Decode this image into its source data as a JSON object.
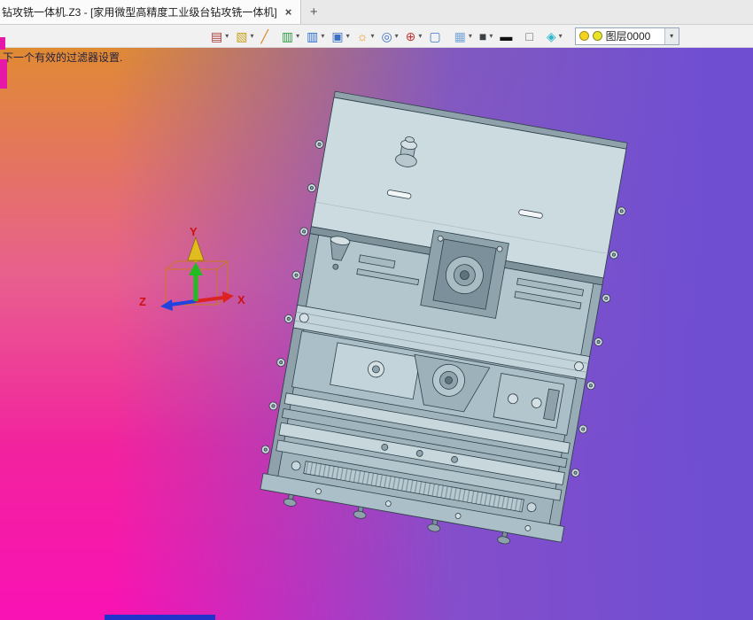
{
  "tab_bar": {
    "active_tab": {
      "title": "钻攻铣一体机.Z3 - [家用微型高精度工业级台钻攻铣一体机]",
      "close_label": "×"
    },
    "new_tab_label": "+"
  },
  "toolbar": {
    "icons": [
      {
        "name": "paste-icon",
        "glyph": "▤",
        "color": "#a83838",
        "dropdown": "▾"
      },
      {
        "name": "fill-color-icon",
        "glyph": "▧",
        "color": "#c8a020",
        "dropdown": "▾"
      },
      {
        "name": "pencil-icon",
        "glyph": "╱",
        "color": "#d9821a",
        "dropdown": ""
      },
      {
        "name": "material-green-icon",
        "glyph": "▥",
        "color": "#2f9e44",
        "dropdown": "▾"
      },
      {
        "name": "material-blue-icon",
        "glyph": "▥",
        "color": "#2f6fd0",
        "dropdown": "▾"
      },
      {
        "name": "layer-stack-icon",
        "glyph": "▣",
        "color": "#3b6fc4",
        "dropdown": "▾"
      },
      {
        "name": "gear-icon",
        "glyph": "☼",
        "color": "#e8961e",
        "dropdown": "▾"
      },
      {
        "name": "zoom-icon",
        "glyph": "◎",
        "color": "#3b6fc4",
        "dropdown": "▾"
      },
      {
        "name": "locator-pin-icon",
        "glyph": "⊕",
        "color": "#c03838",
        "dropdown": "▾"
      },
      {
        "name": "select-region-icon",
        "glyph": "▢",
        "color": "#4078c8",
        "dropdown": ""
      },
      {
        "name": "grid-icon",
        "glyph": "▦",
        "color": "#7aa6d8",
        "dropdown": "▾"
      },
      {
        "name": "display-icon",
        "glyph": "■",
        "color": "#3a4248",
        "dropdown": "▾"
      },
      {
        "name": "line-width-icon",
        "glyph": "▬",
        "color": "#101010",
        "dropdown": ""
      },
      {
        "name": "color-swatch-icon",
        "glyph": "□",
        "color": "#606060",
        "dropdown": ""
      },
      {
        "name": "shaded-view-icon",
        "glyph": "◈",
        "color": "#2ab6c8",
        "dropdown": "▾"
      }
    ],
    "layer_combo": {
      "value": "图层0000",
      "dropdown": "▾"
    }
  },
  "canvas": {
    "prompt": "下一个有效的过滤器设置.",
    "gradient": {
      "top_left": "#e08a33",
      "bottom_left": "#f912b4",
      "right": "#6f4ed2"
    },
    "triad": {
      "x_label": "X",
      "y_label": "Y",
      "z_label": "Z",
      "x_color": "#dd2222",
      "y_color": "#22bb22",
      "z_color": "#2244dd",
      "cone_color": "#e2bc1e",
      "box_color": "#c87a1e",
      "label_color": "#cc1111"
    },
    "model": {
      "body_color": "#c9d9df",
      "edge_color": "#2f4049"
    }
  },
  "fragments": {
    "left_strip_color": "#e618a8",
    "bottom_bar_color": "#2233cc"
  }
}
